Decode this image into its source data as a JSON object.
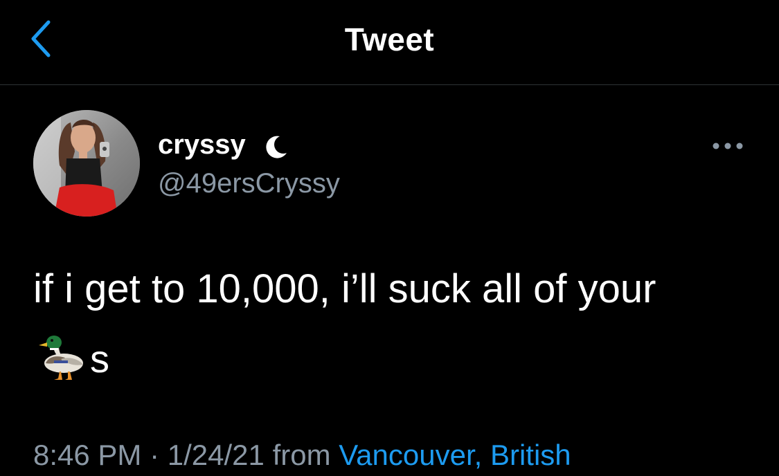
{
  "header": {
    "title": "Tweet",
    "back_icon": "chevron-left-icon",
    "accent_color": "#1d9bf0"
  },
  "tweet": {
    "author": {
      "display_name": "cryssy",
      "status_icon": "crescent-moon-icon",
      "handle": "@49ersCryssy"
    },
    "more_icon": "ellipsis-icon",
    "text_line": "if i get to 10,000, i’ll suck all of your",
    "emoji_icon": "duck-emoji",
    "emoji_suffix": "s",
    "time": "8:46 PM",
    "separator": "·",
    "date": "1/24/21",
    "from_label": "from",
    "source": "Vancouver, British"
  }
}
